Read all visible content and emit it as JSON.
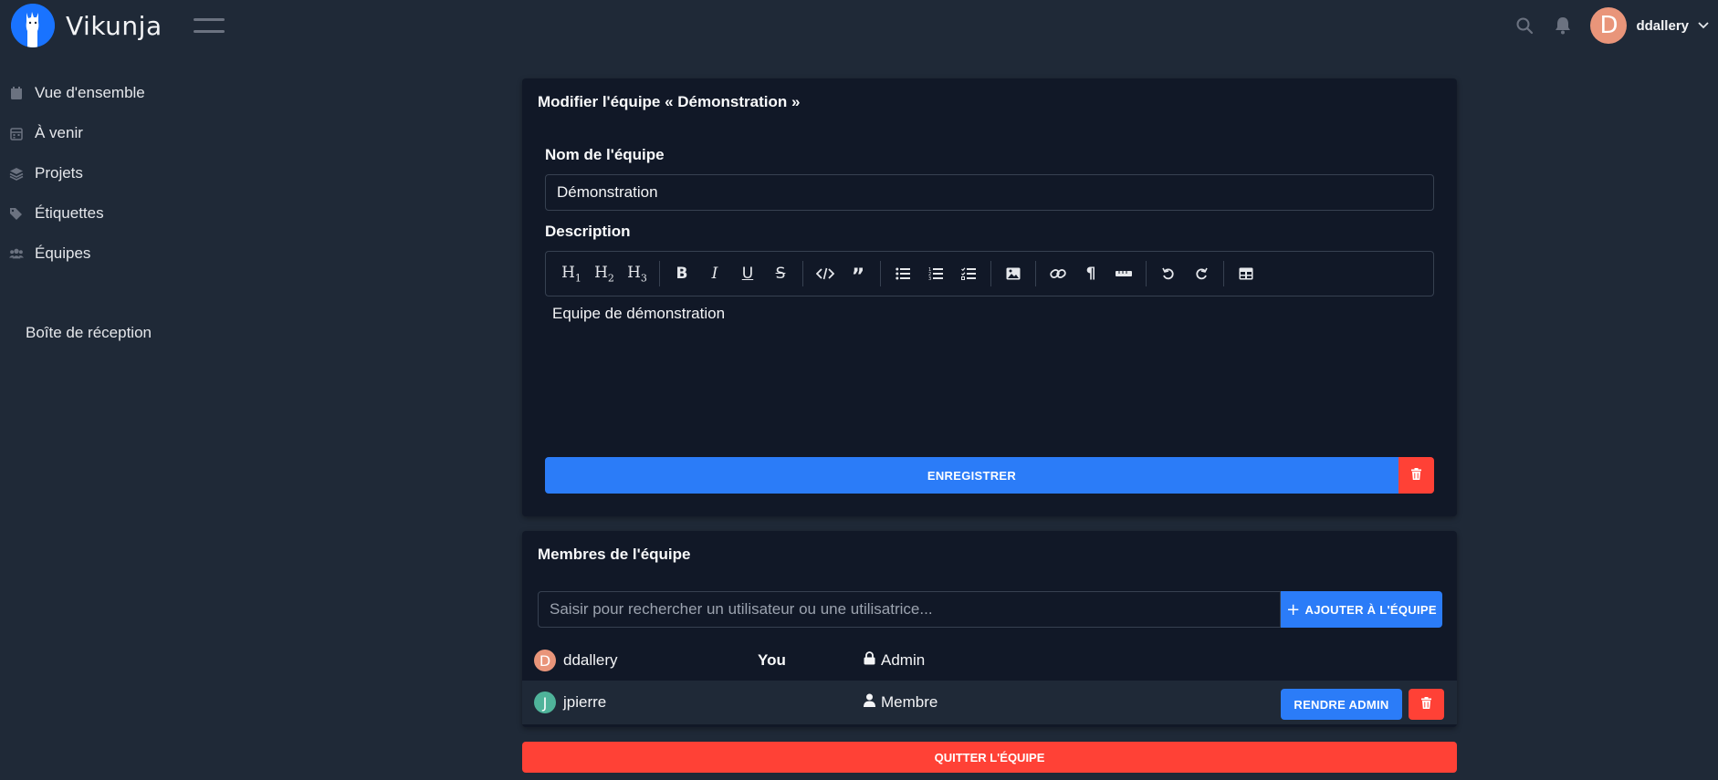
{
  "app": {
    "name": "Vikunja"
  },
  "header": {
    "username": "ddallery",
    "avatar_letter": "D",
    "avatar_color": "#e9957a"
  },
  "sidebar": {
    "items": [
      {
        "label": "Vue d'ensemble",
        "icon": "calendar-icon"
      },
      {
        "label": "À venir",
        "icon": "calendar-grid-icon"
      },
      {
        "label": "Projets",
        "icon": "layers-icon"
      },
      {
        "label": "Étiquettes",
        "icon": "tags-icon"
      },
      {
        "label": "Équipes",
        "icon": "users-icon"
      }
    ],
    "inbox": "Boîte de réception"
  },
  "edit_team": {
    "title": "Modifier l'équipe « Démonstration »",
    "name_label": "Nom de l'équipe",
    "name_value": "Démonstration",
    "description_label": "Description",
    "description_value": "Equipe de démonstration",
    "save_label": "ENREGISTRER"
  },
  "members": {
    "title": "Membres de l'équipe",
    "search_placeholder": "Saisir pour rechercher un utilisateur ou une utilisatrice...",
    "add_label": "AJOUTER À L'ÉQUIPE",
    "rows": [
      {
        "name": "ddallery",
        "avatar_letter": "D",
        "avatar_color": "#e9957a",
        "you": "You",
        "role": "Admin",
        "role_icon": "lock-icon"
      },
      {
        "name": "jpierre",
        "avatar_letter": "J",
        "avatar_color": "#4fb39a",
        "you": "",
        "role": "Membre",
        "role_icon": "user-icon",
        "make_admin_label": "RENDRE ADMIN"
      }
    ],
    "leave_label": "QUITTER L'ÉQUIPE"
  },
  "colors": {
    "primary": "#2b7cf8",
    "danger": "#ff4136",
    "background": "#1f2937",
    "card": "#111827"
  }
}
